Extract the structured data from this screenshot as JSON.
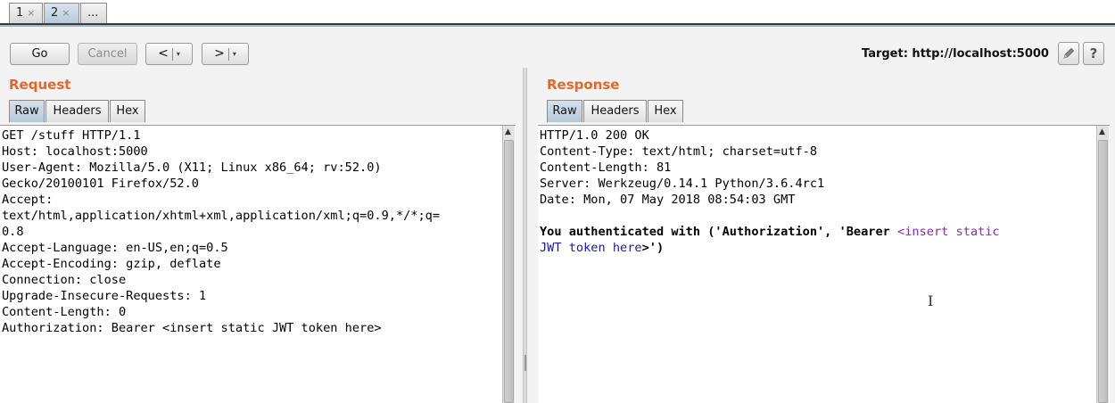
{
  "tabs": [
    {
      "label": "1",
      "close": "×"
    },
    {
      "label": "2",
      "close": "×"
    },
    {
      "label": "..."
    }
  ],
  "toolbar": {
    "go_label": "Go",
    "cancel_label": "Cancel",
    "back_label": "<",
    "forward_label": ">",
    "dropdown_glyph": "▾",
    "target_text": "Target: http://localhost:5000",
    "edit_icon": "pencil-icon",
    "help_label": "?"
  },
  "request": {
    "title": "Request",
    "tabs": [
      "Raw",
      "Headers",
      "Hex"
    ],
    "lines": [
      "GET /stuff HTTP/1.1",
      "Host: localhost:5000",
      "User-Agent: Mozilla/5.0 (X11; Linux x86_64; rv:52.0)",
      "Gecko/20100101 Firefox/52.0",
      "Accept:",
      "text/html,application/xhtml+xml,application/xml;q=0.9,*/*;q=",
      "0.8",
      "Accept-Language: en-US,en;q=0.5",
      "Accept-Encoding: gzip, deflate",
      "Connection: close",
      "Upgrade-Insecure-Requests: 1",
      "Content-Length: 0",
      "Authorization: Bearer <insert static JWT token here>"
    ]
  },
  "response": {
    "title": "Response",
    "tabs": [
      "Raw",
      "Headers",
      "Hex"
    ],
    "lines": [
      "HTTP/1.0 200 OK",
      "Content-Type: text/html; charset=utf-8",
      "Content-Length: 81",
      "Server: Werkzeug/0.14.1 Python/3.6.4rc1",
      "Date: Mon, 07 May 2018 08:54:03 GMT"
    ],
    "body_line1_prefix": "You authenticated with ('Authorization', 'Bearer ",
    "body_line1_tag_open": "<",
    "body_line1_tag_text": "insert static",
    "body_line2_tag_text": "JWT token here",
    "body_line2_tag_close": ">",
    "body_line2_suffix": "')"
  },
  "colors": {
    "section_title": "#e4682c",
    "html_tag": "#8a2bb0",
    "html_text": "#1a1a9c"
  }
}
